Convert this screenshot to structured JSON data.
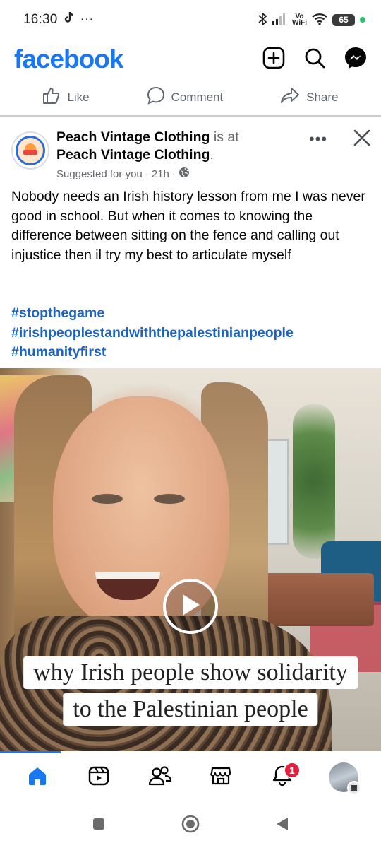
{
  "status_bar": {
    "time": "16:30",
    "dots": "···",
    "wifi_label_top": "Vo",
    "wifi_label_bottom": "WiFi",
    "battery": "65",
    "colors": {
      "battery_bg": "#3a3a3a",
      "charging_dot": "#25c26e"
    }
  },
  "app_bar": {
    "logo": "facebook",
    "icons": [
      "plus-square-icon",
      "search-icon",
      "messenger-icon"
    ],
    "colors": {
      "brand": "#1877f2"
    }
  },
  "action_strip": {
    "like": "Like",
    "comment": "Comment",
    "share": "Share"
  },
  "post": {
    "page_name": "Peach Vintage Clothing",
    "is_at": "is at",
    "location": "Peach Vintage Clothing",
    "location_suffix": ".",
    "suggested": "Suggested for you",
    "sep1": "·",
    "time": "21h",
    "sep2": "·",
    "more": "•••",
    "text": "Nobody needs an Irish history lesson from me I was never good in school. But when it comes to knowing the difference between sitting on the fence and calling out injustice then il try my best to articulate myself",
    "hashtags": [
      "#stopthegame",
      "#irishpeoplestandwiththepalestinianpeople",
      "#humanityfirst"
    ],
    "colors": {
      "hashtag": "#1a63c4",
      "muted": "#65676b"
    }
  },
  "video": {
    "caption_line1": "why Irish people show solidarity",
    "caption_line2": "to the Palestinian people",
    "icons": [
      "play-icon"
    ]
  },
  "bottom_nav": {
    "items": [
      "home-icon",
      "reels-icon",
      "friends-icon",
      "marketplace-icon",
      "notifications-icon",
      "profile-menu"
    ],
    "notification_count": "1",
    "colors": {
      "active": "#1877f2",
      "badge": "#e41e3f"
    }
  },
  "system_nav": {
    "icons": [
      "recents-square-icon",
      "home-circle-icon",
      "back-triangle-icon"
    ]
  }
}
